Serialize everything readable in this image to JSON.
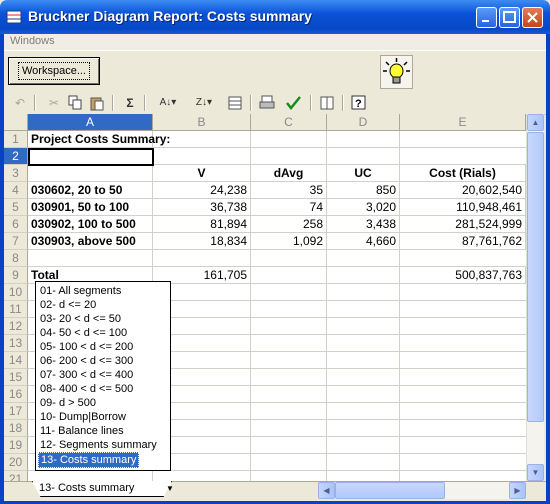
{
  "window": {
    "title": "Bruckner Diagram Report: Costs summary"
  },
  "menu": {
    "items": [
      "Windows"
    ]
  },
  "panel": {
    "workspace_label": "Workspace..."
  },
  "toolbar": {
    "sum_label": "Σ"
  },
  "columns": [
    "A",
    "B",
    "C",
    "D",
    "E"
  ],
  "rows": [
    "1",
    "2",
    "3",
    "4",
    "5",
    "6",
    "7",
    "8",
    "9",
    "10",
    "11",
    "12",
    "13",
    "14",
    "15",
    "16",
    "17",
    "18",
    "19",
    "20",
    "21"
  ],
  "cells": {
    "a1": "Project Costs Summary:",
    "b3": "V",
    "c3": "dAvg",
    "d3": "UC",
    "e3": "Cost (Rials)",
    "a4": "030602, 20 to 50",
    "b4": "24,238",
    "c4": "35",
    "d4": "850",
    "e4": "20,602,540",
    "a5": "030901, 50 to 100",
    "b5": "36,738",
    "c5": "74",
    "d5": "3,020",
    "e5": "110,948,461",
    "a6": "030902, 100 to 500",
    "b6": "81,894",
    "c6": "258",
    "d6": "3,438",
    "e6": "281,524,999",
    "a7": "030903, above 500",
    "b7": "18,834",
    "c7": "1,092",
    "d7": "4,660",
    "e7": "87,761,762",
    "a9": "Total",
    "b9": "161,705",
    "e9": "500,837,763"
  },
  "dropdown": {
    "items": [
      "01-  All segments",
      "02-  d <= 20",
      "03-  20 < d <= 50",
      "04-  50 < d <= 100",
      "05-  100 < d <= 200",
      "06-  200 < d <= 300",
      "07-  300 < d <= 400",
      "08-  400 < d <= 500",
      "09-  d > 500",
      "10-  Dump|Borrow",
      "11-  Balance lines",
      "12-  Segments summary",
      "13-  Costs summary"
    ],
    "selected_index": 12
  },
  "sheet_tab": {
    "label": "13-  Costs summary"
  },
  "colors": {
    "title_bar": "#0a52d8",
    "selection": "#316ac5"
  }
}
